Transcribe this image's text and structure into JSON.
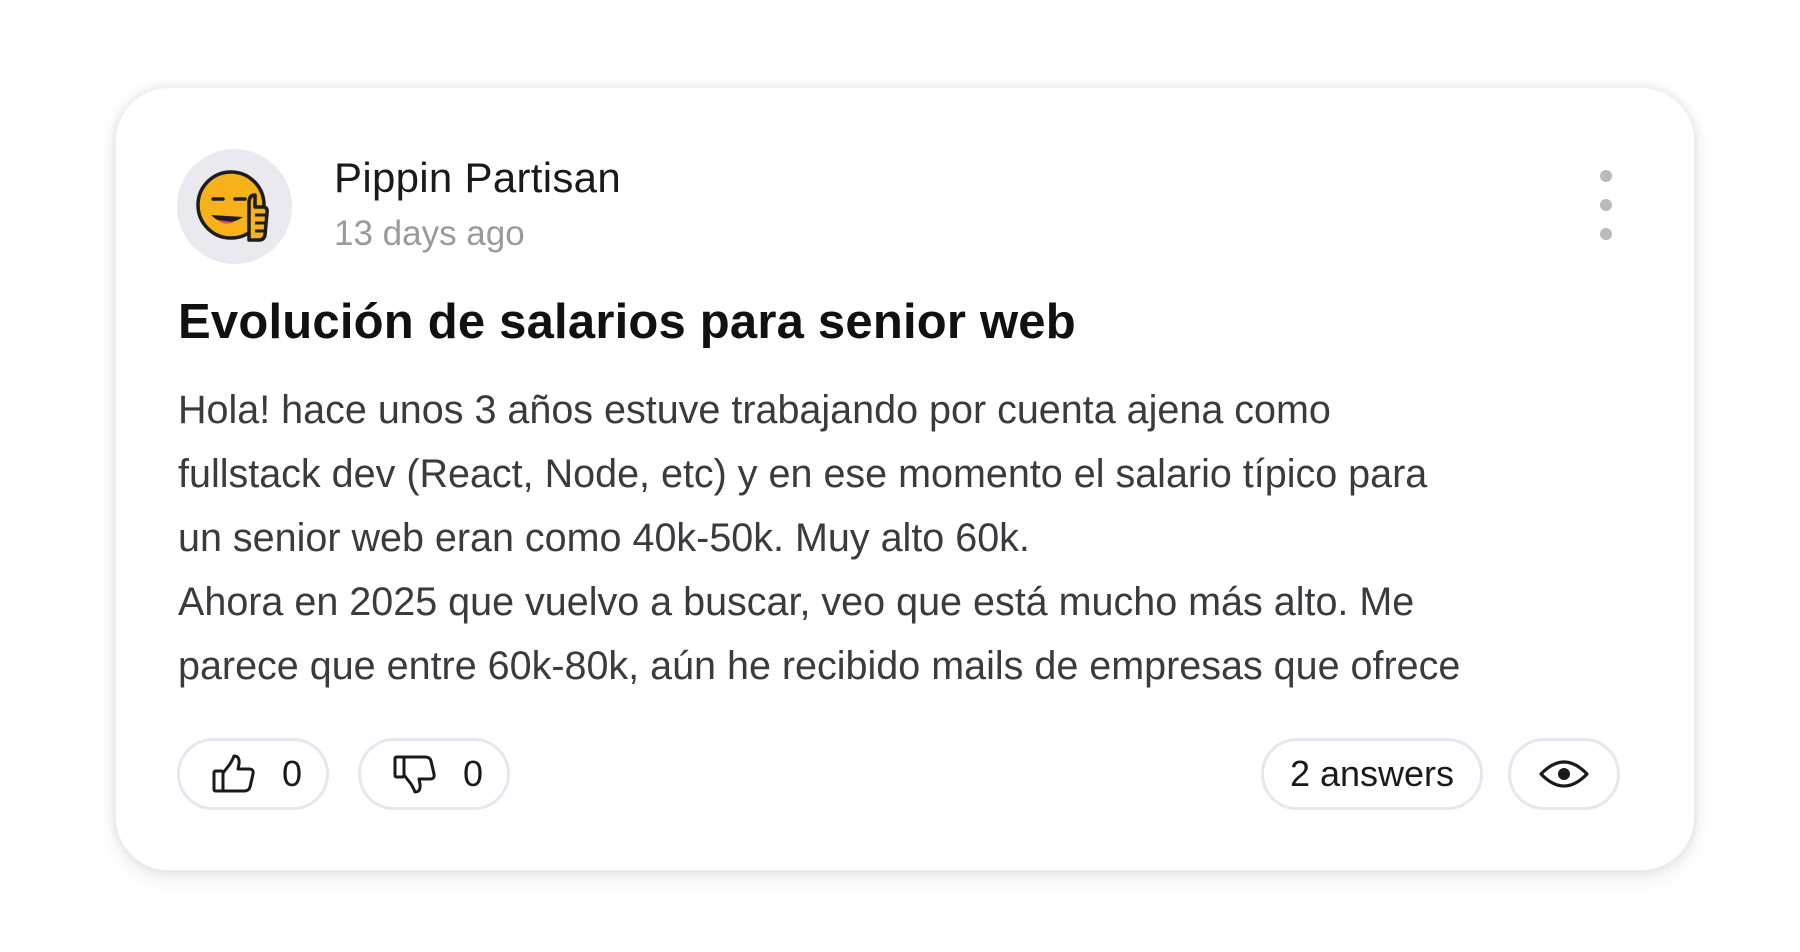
{
  "post": {
    "author": {
      "name": "Pippin Partisan",
      "timestamp": "13 days ago",
      "avatar_icon": "smirking-thumbs-up-emoji-icon"
    },
    "menu_icon": "vertical-ellipsis-icon",
    "title": "Evolución de salarios para senior web",
    "body_lines": [
      "Hola! hace unos 3 años estuve trabajando por cuenta ajena como",
      "fullstack dev (React, Node, etc) y en ese momento el salario típico para",
      "un senior web eran como 40k-50k. Muy alto 60k.",
      "Ahora en 2025 que vuelvo a buscar, veo que está mucho más alto. Me",
      "parece que entre 60k-80k, aún he recibido mails de empresas que ofrece"
    ],
    "actions": {
      "likes": {
        "icon": "thumbs-up-icon",
        "count": "0"
      },
      "dislikes": {
        "icon": "thumbs-down-icon",
        "count": "0"
      },
      "answers_label": "2 answers",
      "view_icon": "eye-icon"
    }
  },
  "colors": {
    "avatar_bg": "#e9e9ef",
    "emoji_yellow": "#f7b21b",
    "pill_border": "#e8e6f0",
    "muted_text": "#9a9a9e",
    "body_text": "#3a3a3f"
  }
}
